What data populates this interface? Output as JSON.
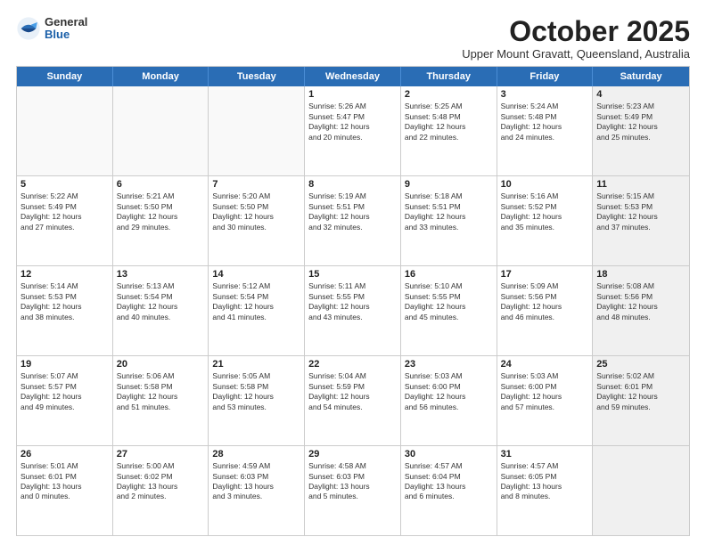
{
  "logo": {
    "general": "General",
    "blue": "Blue"
  },
  "title": "October 2025",
  "subtitle": "Upper Mount Gravatt, Queensland, Australia",
  "days": [
    "Sunday",
    "Monday",
    "Tuesday",
    "Wednesday",
    "Thursday",
    "Friday",
    "Saturday"
  ],
  "weeks": [
    [
      {
        "day": "",
        "empty": true
      },
      {
        "day": "",
        "empty": true
      },
      {
        "day": "",
        "empty": true
      },
      {
        "day": "1",
        "line1": "Sunrise: 5:26 AM",
        "line2": "Sunset: 5:47 PM",
        "line3": "Daylight: 12 hours",
        "line4": "and 20 minutes."
      },
      {
        "day": "2",
        "line1": "Sunrise: 5:25 AM",
        "line2": "Sunset: 5:48 PM",
        "line3": "Daylight: 12 hours",
        "line4": "and 22 minutes."
      },
      {
        "day": "3",
        "line1": "Sunrise: 5:24 AM",
        "line2": "Sunset: 5:48 PM",
        "line3": "Daylight: 12 hours",
        "line4": "and 24 minutes."
      },
      {
        "day": "4",
        "line1": "Sunrise: 5:23 AM",
        "line2": "Sunset: 5:49 PM",
        "line3": "Daylight: 12 hours",
        "line4": "and 25 minutes.",
        "shaded": true
      }
    ],
    [
      {
        "day": "5",
        "line1": "Sunrise: 5:22 AM",
        "line2": "Sunset: 5:49 PM",
        "line3": "Daylight: 12 hours",
        "line4": "and 27 minutes."
      },
      {
        "day": "6",
        "line1": "Sunrise: 5:21 AM",
        "line2": "Sunset: 5:50 PM",
        "line3": "Daylight: 12 hours",
        "line4": "and 29 minutes."
      },
      {
        "day": "7",
        "line1": "Sunrise: 5:20 AM",
        "line2": "Sunset: 5:50 PM",
        "line3": "Daylight: 12 hours",
        "line4": "and 30 minutes."
      },
      {
        "day": "8",
        "line1": "Sunrise: 5:19 AM",
        "line2": "Sunset: 5:51 PM",
        "line3": "Daylight: 12 hours",
        "line4": "and 32 minutes."
      },
      {
        "day": "9",
        "line1": "Sunrise: 5:18 AM",
        "line2": "Sunset: 5:51 PM",
        "line3": "Daylight: 12 hours",
        "line4": "and 33 minutes."
      },
      {
        "day": "10",
        "line1": "Sunrise: 5:16 AM",
        "line2": "Sunset: 5:52 PM",
        "line3": "Daylight: 12 hours",
        "line4": "and 35 minutes."
      },
      {
        "day": "11",
        "line1": "Sunrise: 5:15 AM",
        "line2": "Sunset: 5:53 PM",
        "line3": "Daylight: 12 hours",
        "line4": "and 37 minutes.",
        "shaded": true
      }
    ],
    [
      {
        "day": "12",
        "line1": "Sunrise: 5:14 AM",
        "line2": "Sunset: 5:53 PM",
        "line3": "Daylight: 12 hours",
        "line4": "and 38 minutes."
      },
      {
        "day": "13",
        "line1": "Sunrise: 5:13 AM",
        "line2": "Sunset: 5:54 PM",
        "line3": "Daylight: 12 hours",
        "line4": "and 40 minutes."
      },
      {
        "day": "14",
        "line1": "Sunrise: 5:12 AM",
        "line2": "Sunset: 5:54 PM",
        "line3": "Daylight: 12 hours",
        "line4": "and 41 minutes."
      },
      {
        "day": "15",
        "line1": "Sunrise: 5:11 AM",
        "line2": "Sunset: 5:55 PM",
        "line3": "Daylight: 12 hours",
        "line4": "and 43 minutes."
      },
      {
        "day": "16",
        "line1": "Sunrise: 5:10 AM",
        "line2": "Sunset: 5:55 PM",
        "line3": "Daylight: 12 hours",
        "line4": "and 45 minutes."
      },
      {
        "day": "17",
        "line1": "Sunrise: 5:09 AM",
        "line2": "Sunset: 5:56 PM",
        "line3": "Daylight: 12 hours",
        "line4": "and 46 minutes."
      },
      {
        "day": "18",
        "line1": "Sunrise: 5:08 AM",
        "line2": "Sunset: 5:56 PM",
        "line3": "Daylight: 12 hours",
        "line4": "and 48 minutes.",
        "shaded": true
      }
    ],
    [
      {
        "day": "19",
        "line1": "Sunrise: 5:07 AM",
        "line2": "Sunset: 5:57 PM",
        "line3": "Daylight: 12 hours",
        "line4": "and 49 minutes."
      },
      {
        "day": "20",
        "line1": "Sunrise: 5:06 AM",
        "line2": "Sunset: 5:58 PM",
        "line3": "Daylight: 12 hours",
        "line4": "and 51 minutes."
      },
      {
        "day": "21",
        "line1": "Sunrise: 5:05 AM",
        "line2": "Sunset: 5:58 PM",
        "line3": "Daylight: 12 hours",
        "line4": "and 53 minutes."
      },
      {
        "day": "22",
        "line1": "Sunrise: 5:04 AM",
        "line2": "Sunset: 5:59 PM",
        "line3": "Daylight: 12 hours",
        "line4": "and 54 minutes."
      },
      {
        "day": "23",
        "line1": "Sunrise: 5:03 AM",
        "line2": "Sunset: 6:00 PM",
        "line3": "Daylight: 12 hours",
        "line4": "and 56 minutes."
      },
      {
        "day": "24",
        "line1": "Sunrise: 5:03 AM",
        "line2": "Sunset: 6:00 PM",
        "line3": "Daylight: 12 hours",
        "line4": "and 57 minutes."
      },
      {
        "day": "25",
        "line1": "Sunrise: 5:02 AM",
        "line2": "Sunset: 6:01 PM",
        "line3": "Daylight: 12 hours",
        "line4": "and 59 minutes.",
        "shaded": true
      }
    ],
    [
      {
        "day": "26",
        "line1": "Sunrise: 5:01 AM",
        "line2": "Sunset: 6:01 PM",
        "line3": "Daylight: 13 hours",
        "line4": "and 0 minutes."
      },
      {
        "day": "27",
        "line1": "Sunrise: 5:00 AM",
        "line2": "Sunset: 6:02 PM",
        "line3": "Daylight: 13 hours",
        "line4": "and 2 minutes."
      },
      {
        "day": "28",
        "line1": "Sunrise: 4:59 AM",
        "line2": "Sunset: 6:03 PM",
        "line3": "Daylight: 13 hours",
        "line4": "and 3 minutes."
      },
      {
        "day": "29",
        "line1": "Sunrise: 4:58 AM",
        "line2": "Sunset: 6:03 PM",
        "line3": "Daylight: 13 hours",
        "line4": "and 5 minutes."
      },
      {
        "day": "30",
        "line1": "Sunrise: 4:57 AM",
        "line2": "Sunset: 6:04 PM",
        "line3": "Daylight: 13 hours",
        "line4": "and 6 minutes."
      },
      {
        "day": "31",
        "line1": "Sunrise: 4:57 AM",
        "line2": "Sunset: 6:05 PM",
        "line3": "Daylight: 13 hours",
        "line4": "and 8 minutes."
      },
      {
        "day": "",
        "empty": true,
        "shaded": true
      }
    ]
  ]
}
